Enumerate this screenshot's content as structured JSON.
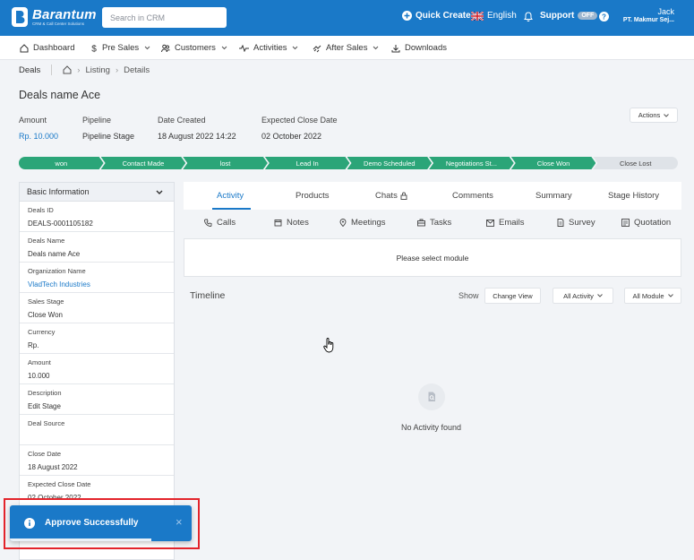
{
  "app": {
    "logo_title": "Barantum",
    "logo_subtitle": "CRM & Call Center Solutions"
  },
  "topbar": {
    "search_placeholder": "Search in CRM",
    "quick_create": "Quick Create",
    "language": "English",
    "support": "Support",
    "support_badge": "OFF",
    "user_name": "Jack",
    "user_company": "PT. Makmur Sej..."
  },
  "nav": {
    "items": [
      {
        "label": "Dashboard",
        "icon": "home-icon"
      },
      {
        "label": "Pre Sales",
        "icon": "dollar-icon"
      },
      {
        "label": "Customers",
        "icon": "users-icon"
      },
      {
        "label": "Activities",
        "icon": "activity-icon"
      },
      {
        "label": "After Sales",
        "icon": "handshake-icon"
      },
      {
        "label": "Downloads",
        "icon": "download-icon"
      }
    ]
  },
  "breadcrumb": {
    "root": "Deals",
    "listing": "Listing",
    "details": "Details"
  },
  "page": {
    "title": "Deals name Ace",
    "actions_label": "Actions"
  },
  "summary": {
    "amount_label": "Amount",
    "amount_value": "Rp. 10.000",
    "pipeline_label": "Pipeline",
    "pipeline_value": "Pipeline Stage",
    "date_created_label": "Date Created",
    "date_created_value": "18 August 2022 14:22",
    "expected_close_label": "Expected Close Date",
    "expected_close_value": "02 October 2022"
  },
  "stages": [
    "won",
    "Contact Made",
    "lost",
    "Lead In",
    "Demo Scheduled",
    "Negotiations St...",
    "Close Won",
    "Close Lost"
  ],
  "basic_info": {
    "header": "Basic Information",
    "fields": [
      {
        "label": "Deals ID",
        "value": "DEALS-0001105182"
      },
      {
        "label": "Deals Name",
        "value": "Deals name Ace"
      },
      {
        "label": "Organization Name",
        "value": "VladTech Industries"
      },
      {
        "label": "Sales Stage",
        "value": "Close Won"
      },
      {
        "label": "Currency",
        "value": "Rp."
      },
      {
        "label": "Amount",
        "value": "10.000"
      },
      {
        "label": "Description",
        "value": "Edit Stage"
      },
      {
        "label": "Deal Source",
        "value": ""
      },
      {
        "label": "Close Date",
        "value": "18 August 2022"
      },
      {
        "label": "Expected Close Date",
        "value": "02 October 2022"
      }
    ]
  },
  "tabs": [
    "Activity",
    "Products",
    "Chats",
    "Comments",
    "Summary",
    "Stage History"
  ],
  "subtabs": [
    "Calls",
    "Notes",
    "Meetings",
    "Tasks",
    "Emails",
    "Survey",
    "Quotation"
  ],
  "module_message": "Please select module",
  "timeline": {
    "title": "Timeline",
    "show_label": "Show",
    "change_view": "Change View",
    "all_activity": "All Activity",
    "all_module": "All Module",
    "empty_text": "No Activity found"
  },
  "toast": {
    "message": "Approve Successfully",
    "close": "×",
    "progress": 0.78
  },
  "colors": {
    "primary": "#1a79c8",
    "stage_green": "#2ba578",
    "stage_grey": "#dfe3e8",
    "highlight": "#e3242b"
  }
}
